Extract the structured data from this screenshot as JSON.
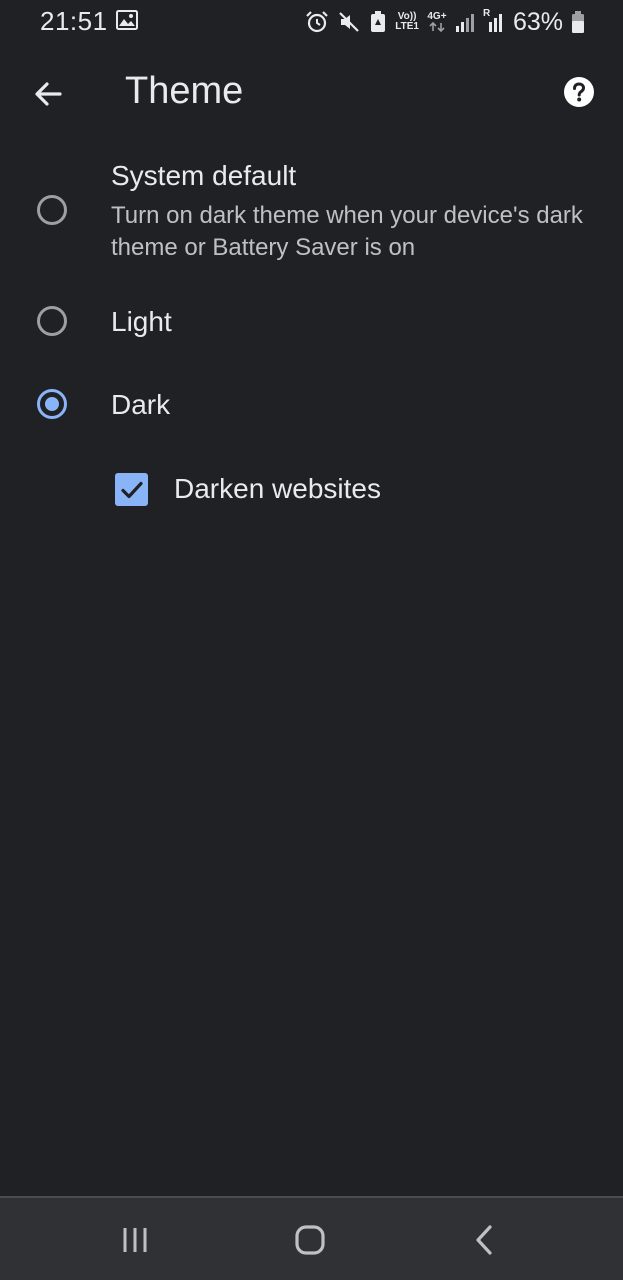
{
  "status_bar": {
    "time": "21:51",
    "battery_percent": "63%",
    "net_top": "Vo))",
    "net_bottom": "LTE1",
    "net_type": "4G+",
    "roaming": "R",
    "icons": [
      "gallery-icon",
      "alarm-icon",
      "mute-icon",
      "battery-saver-icon",
      "signal-icon",
      "battery-icon"
    ]
  },
  "toolbar": {
    "title": "Theme",
    "back_icon": "arrow-back-icon",
    "help_icon": "help-icon"
  },
  "theme_options": [
    {
      "label": "System default",
      "description": "Turn on dark theme when your device's dark theme or Battery Saver is on",
      "selected": false
    },
    {
      "label": "Light",
      "selected": false
    },
    {
      "label": "Dark",
      "selected": true
    }
  ],
  "darken_websites": {
    "label": "Darken websites",
    "checked": true
  },
  "colors": {
    "background": "#202124",
    "accent": "#8ab4f8",
    "nav_bar": "#303134"
  },
  "nav_bar": {
    "icons": [
      "recents-icon",
      "home-icon",
      "back-icon"
    ]
  }
}
